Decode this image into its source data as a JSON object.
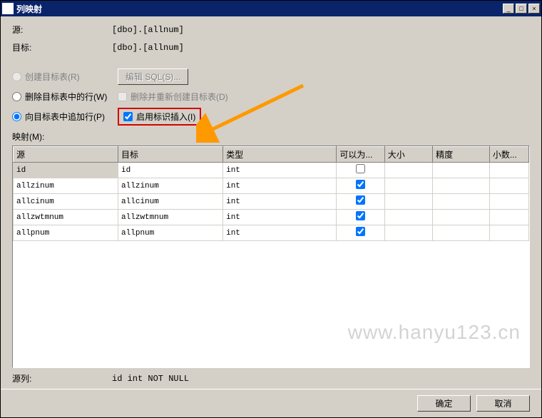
{
  "titlebar": {
    "title": "列映射"
  },
  "labels": {
    "source": "源:",
    "target": "目标:",
    "mapping": "映射(M):",
    "source_col": "源列:"
  },
  "values": {
    "source": "[dbo].[allnum]",
    "target": "[dbo].[allnum]",
    "source_col": "id int NOT NULL"
  },
  "options": {
    "create_table": "创建目标表(R)",
    "edit_sql_btn": "编辑 SQL(S)...",
    "delete_rows": "删除目标表中的行(W)",
    "drop_recreate": "删除并重新创建目标表(D)",
    "append_rows": "向目标表中追加行(P)",
    "identity_insert": "启用标识插入(I)"
  },
  "table": {
    "headers": {
      "source": "源",
      "target": "目标",
      "type": "类型",
      "nullable": "可以为...",
      "size": "大小",
      "precision": "精度",
      "scale": "小数..."
    },
    "rows": [
      {
        "source": "id",
        "target": "id",
        "type": "int",
        "nullable": false
      },
      {
        "source": "allzinum",
        "target": "allzinum",
        "type": "int",
        "nullable": true
      },
      {
        "source": "allcinum",
        "target": "allcinum",
        "type": "int",
        "nullable": true
      },
      {
        "source": "allzwtmnum",
        "target": "allzwtmnum",
        "type": "int",
        "nullable": true
      },
      {
        "source": "allpnum",
        "target": "allpnum",
        "type": "int",
        "nullable": true
      }
    ]
  },
  "buttons": {
    "ok": "确定",
    "cancel": "取消"
  },
  "watermark": "www.hanyu123.cn"
}
